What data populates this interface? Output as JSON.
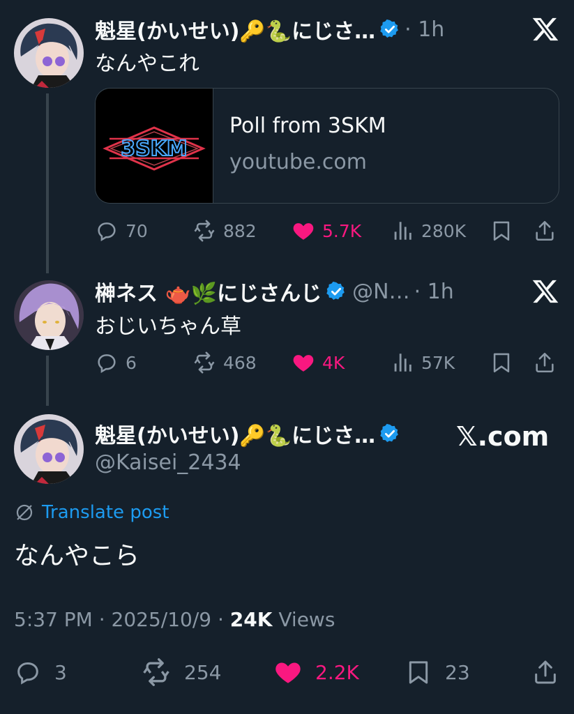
{
  "colors": {
    "background": "#15202b",
    "text": "#f7f9f9",
    "muted": "#8b98a5",
    "like": "#f91880",
    "link": "#1d9bf0",
    "verified": "#1d9bf0"
  },
  "post1": {
    "name": "魁星(かいせい)🔑🐍にじさ…",
    "time": "· 1h",
    "text": "なんやこれ",
    "card": {
      "title": "Poll from 3SKM",
      "domain": "youtube.com",
      "logo_text": "3SKM"
    },
    "stats": {
      "replies": "70",
      "reposts": "882",
      "likes": "5.7K",
      "views": "280K"
    }
  },
  "post2": {
    "name": "榊ネス 🫖🌿にじさんじ",
    "handle": "@N…",
    "time": "· 1h",
    "text": "おじいちゃん草",
    "stats": {
      "replies": "6",
      "reposts": "468",
      "likes": "4K",
      "views": "57K"
    }
  },
  "main": {
    "name": "魁星(かいせい)🔑🐍にじさ…",
    "handle": "@Kaisei_2434",
    "brand": "𝕏.com",
    "translate": "Translate post",
    "text": "なんやこら",
    "timestamp": "5:37 PM · 2025/10/9 ·",
    "views_count": "24K",
    "views_label": "Views",
    "stats": {
      "replies": "3",
      "reposts": "254",
      "likes": "2.2K",
      "bookmarks": "23"
    }
  }
}
